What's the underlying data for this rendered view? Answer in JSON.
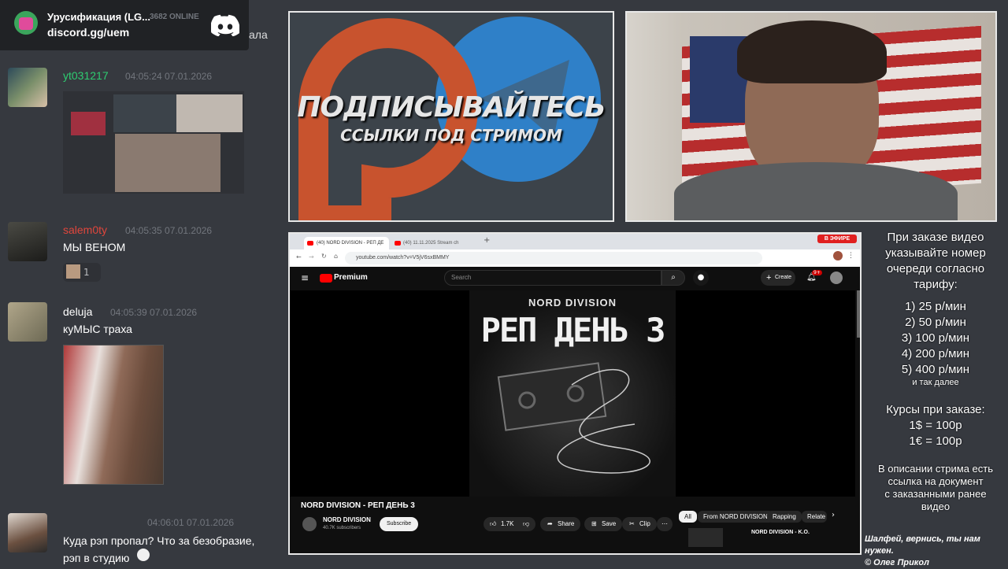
{
  "discord": {
    "server_name": "Урусификация (LG...",
    "online_count": "3682 ONLINE",
    "invite": "discord.gg/uem",
    "cut_text": "ала"
  },
  "messages": [
    {
      "username": "yt031217",
      "time": "04:05:24 07.01.2026",
      "color": "#2ecc71",
      "text": ""
    },
    {
      "username": "salem0ty",
      "time": "04:05:35 07.01.2026",
      "color": "#e0463c",
      "text": "МЫ ВЕНОМ",
      "reaction_count": "1"
    },
    {
      "username": "deluja",
      "time": "04:05:39 07.01.2026",
      "color": "#ffffff",
      "text": "куМЫС траха"
    },
    {
      "username": "",
      "time": "04:06:01 07.01.2026",
      "color": "#ffffff",
      "text": "Куда рэп пропал? Что за безобразие,",
      "text2": "рэп в студию"
    }
  ],
  "promo": {
    "line1": "ПОДПИСЫВАЙТЕСЬ",
    "line2": "ССЫЛКИ ПОД СТРИМОМ"
  },
  "browser": {
    "tab1": "(40) NORD DIVISION - РЕП ДЕ",
    "tab2": "(40) 11.11.2025 Stream ch",
    "url": "youtube.com/watch?v=V5jV6sxBMMY",
    "live_badge": "В ЭФИРЕ",
    "yt_logo": "Premium",
    "search_placeholder": "Search",
    "create": "Create",
    "notif_count": "9+",
    "cover_artist": "NORD DIVISION",
    "cover_title": "РЕП ДЕНЬ 3",
    "video_title": "NORD DIVISION - РЕП ДЕНЬ 3",
    "channel": "NORD DIVISION",
    "subscribers": "40.7K subscribers",
    "subscribe": "Subscribe",
    "likes": "1.7K",
    "share": "Share",
    "save": "Save",
    "clip": "Clip",
    "chips": [
      "All",
      "From NORD DIVISION",
      "Rapping",
      "Relate"
    ],
    "next_video": "NORD DIVISION - K.O."
  },
  "info": {
    "intro": [
      "При заказе видео",
      "указывайте номер",
      "очереди согласно",
      "тарифу:"
    ],
    "tariffs": [
      "1) 25 р/мин",
      "2) 50 р/мин",
      "3) 100 р/мин",
      "4) 200 р/мин",
      "5) 400 р/мин"
    ],
    "etc": "и так далее",
    "rates_title": "Курсы при заказе:",
    "rates": [
      "1$ = 100р",
      "1€ = 100р"
    ],
    "doc_note": [
      "В описании стрима есть",
      "ссылка на документ",
      "с заказанными ранее",
      "видео"
    ]
  },
  "credits": [
    "Шалфей, вернись, ты нам нужен.",
    "© Олег Прикол"
  ],
  "colors": {
    "discord_bg": "#36393f",
    "discord_dark": "#202225",
    "youtube_red": "#ff0000",
    "telegram": "#2f80c8",
    "patreon": "#c8532e"
  }
}
